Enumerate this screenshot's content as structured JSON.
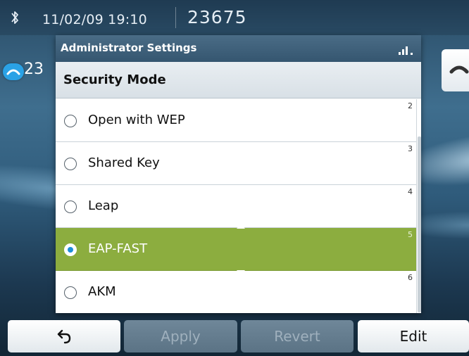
{
  "status_bar": {
    "datetime": "11/02/09 19:10",
    "line_number": "23675",
    "icons": [
      "bluetooth-icon"
    ]
  },
  "background": {
    "line_label": "23",
    "icons": [
      "call-line-icon",
      "handset-icon"
    ]
  },
  "dialog": {
    "title": "Administrator Settings",
    "signal_icon": "signal-strength-icon",
    "header": "Security Mode",
    "options": [
      {
        "label": "Open with WEP",
        "number": "2",
        "selected": false
      },
      {
        "label": "Shared Key",
        "number": "3",
        "selected": false
      },
      {
        "label": "Leap",
        "number": "4",
        "selected": false
      },
      {
        "label": "EAP-FAST",
        "number": "5",
        "selected": true
      },
      {
        "label": "AKM",
        "number": "6",
        "selected": false
      }
    ]
  },
  "softkeys": {
    "back_icon": "back-arrow-icon",
    "apply": "Apply",
    "revert": "Revert",
    "edit": "Edit"
  },
  "colors": {
    "selection": "#8cad3f",
    "titlebar": "#355670",
    "radio_dot": "#1c8fd6"
  }
}
